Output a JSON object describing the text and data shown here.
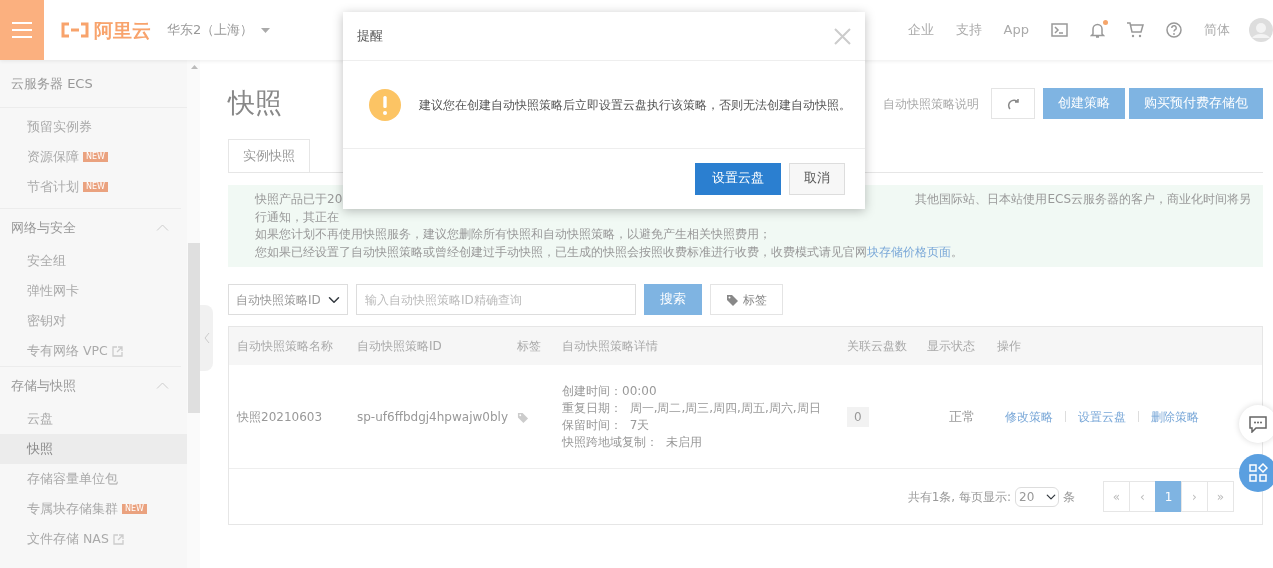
{
  "topbar": {
    "brand": "阿里云",
    "region": "华东2（上海）",
    "nav": [
      "企业",
      "支持",
      "App"
    ],
    "notification_dot": true,
    "language": "简体"
  },
  "sidebar": {
    "title": "云服务器 ECS",
    "sections": [
      {
        "items": [
          {
            "label": "预留实例券",
            "selected": false
          },
          {
            "label": "资源保障",
            "badge": "NEW",
            "selected": false
          },
          {
            "label": "节省计划",
            "badge": "NEW",
            "selected": false
          }
        ]
      },
      {
        "label": "网络与安全",
        "expanded": true,
        "items": [
          {
            "label": "安全组",
            "selected": false
          },
          {
            "label": "弹性网卡",
            "selected": false
          },
          {
            "label": "密钥对",
            "selected": false
          },
          {
            "label": "专有网络 VPC",
            "external": true,
            "selected": false
          }
        ]
      },
      {
        "label": "存储与快照",
        "expanded": true,
        "items": [
          {
            "label": "云盘",
            "selected": false
          },
          {
            "label": "快照",
            "selected": true
          },
          {
            "label": "存储容量单位包",
            "selected": false
          },
          {
            "label": "专属块存储集群",
            "badge": "NEW",
            "selected": false
          },
          {
            "label": "文件存储 NAS",
            "external": true,
            "selected": false
          }
        ]
      }
    ]
  },
  "page": {
    "title": "快照",
    "help_link": "自动快照策略说明",
    "buttons": [
      "创建策略",
      "购买预付费存储包"
    ],
    "tabs": [
      {
        "label": "实例快照",
        "selected": false
      }
    ],
    "notice": {
      "line_1_start": "快照产品已于20",
      "line_1_end": "其他国际站、日本站使用ECS云服务器的客户，商业化时间将另",
      "line_2_start": "行通知，其正在",
      "line_3": "如果您计划不再使用快照服务，建议您删除所有快照和自动快照策略，以避免产生相关快照费用；",
      "line_4": "您如果已经设置了自动快照策略或曾经创建过手动快照，已生成的快照会按照收费标准进行收费，收费模式请见官网",
      "line_4_link": "块存储价格页面",
      "line_4_end": "。"
    },
    "filter": {
      "field": "自动快照策略ID",
      "placeholder": "输入自动快照策略ID精确查询",
      "search_button": "搜索",
      "tag_button": "标签"
    },
    "table": {
      "columns": [
        "自动快照策略名称",
        "自动快照策略ID",
        "标签",
        "自动快照策略详情",
        "关联云盘数",
        "显示状态",
        "操作"
      ],
      "rows": [
        {
          "name": "快照20210603",
          "id": "sp-uf6ffbdgj4hpwajw0bly",
          "details": [
            "创建时间：00:00",
            "重复日期：  周一,周二,周三,周四,周五,周六,周日",
            "保留时间：  7天",
            "快照跨地域复制：  未启用"
          ],
          "disk_count": "0",
          "status": "正常",
          "actions": [
            "修改策略",
            "设置云盘",
            "删除策略"
          ]
        }
      ]
    },
    "pagination": {
      "summary": "共有1条, 每页显示:",
      "page_size": "20",
      "unit": "条",
      "pages": [
        {
          "label": "«",
          "selected": false
        },
        {
          "label": "‹",
          "selected": false
        },
        {
          "label": "1",
          "selected": true
        },
        {
          "label": "›",
          "selected": false
        },
        {
          "label": "»",
          "selected": false
        }
      ]
    }
  },
  "dialog": {
    "title": "提醒",
    "message": "建议您在创建自动快照策略后立即设置云盘执行该策略，否则无法创建自动快照。",
    "primary_button": "设置云盘",
    "cancel_button": "取消"
  }
}
